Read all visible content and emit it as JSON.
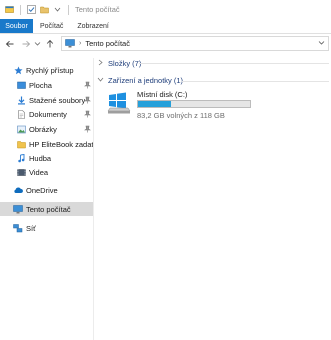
{
  "title_bar": {
    "title": "Tento počítač",
    "qat_icons": [
      "explorer-icon",
      "checkmark-icon",
      "folder-icon",
      "dropdown-icon"
    ]
  },
  "ribbon": {
    "tabs": [
      {
        "label": "Soubor",
        "active": true
      },
      {
        "label": "Počítač"
      },
      {
        "label": "Zobrazení"
      }
    ]
  },
  "address": {
    "path_label": "Tento počítač",
    "icon": "monitor-icon"
  },
  "sidebar": {
    "quick_access": "Rychlý přístup",
    "quick_items": [
      {
        "label": "Plocha",
        "icon": "desktop-folder-icon",
        "pinned": true
      },
      {
        "label": "Stažené soubory",
        "icon": "download-icon",
        "pinned": true
      },
      {
        "label": "Dokumenty",
        "icon": "documents-icon",
        "pinned": true
      },
      {
        "label": "Obrázky",
        "icon": "pictures-icon",
        "pinned": true
      },
      {
        "label": "HP EliteBook zadat",
        "icon": "folder-icon",
        "pinned": false
      },
      {
        "label": "Hudba",
        "icon": "music-icon",
        "pinned": false
      },
      {
        "label": "Videa",
        "icon": "video-icon",
        "pinned": false
      }
    ],
    "onedrive": "OneDrive",
    "this_pc": "Tento počítač",
    "network": "Síť"
  },
  "content": {
    "folders_header": "Složky (7)",
    "devices_header": "Zařízení a jednotky (1)",
    "drive": {
      "name": "Místní disk (C:)",
      "free_text": "83,2 GB volných z 118 GB",
      "used_fraction": 0.295,
      "fill_color": "#26a0da"
    }
  },
  "colors": {
    "accent": "#1979ca",
    "selection": "#d9d9d9",
    "group_header": "#1e3d7a"
  }
}
